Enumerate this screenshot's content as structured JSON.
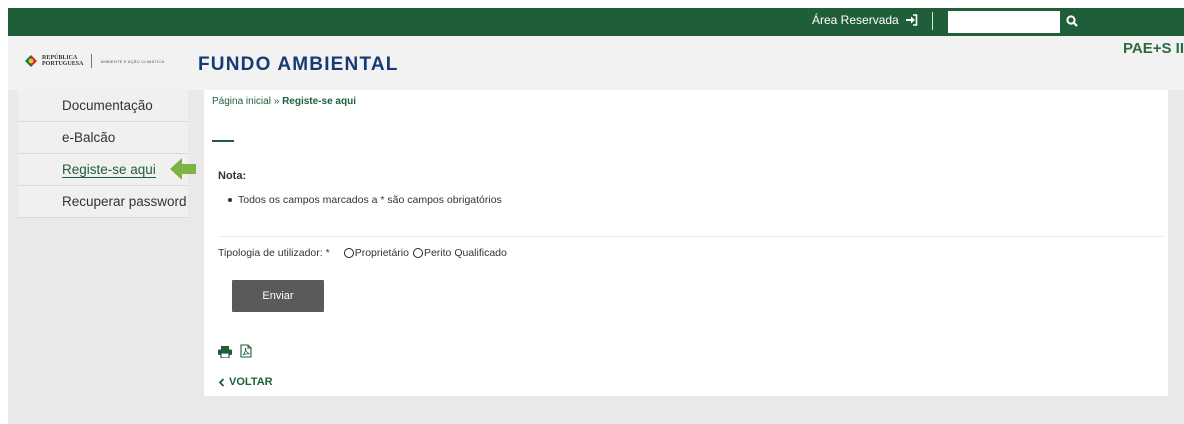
{
  "topbar": {
    "area_reservada": "Área Reservada",
    "search_placeholder": ""
  },
  "header": {
    "rp_line1": "REPÚBLICA",
    "rp_line2": "PORTUGUESA",
    "rp_ministry": "AMBIENTE E AÇÃO CLIMÁTICA",
    "fa_logo": "FUNDO AMBIENTAL",
    "title": "PAE+S II"
  },
  "sidebar": {
    "items": [
      {
        "label": "Documentação"
      },
      {
        "label": "e-Balcão"
      },
      {
        "label": "Registe-se aqui"
      },
      {
        "label": "Recuperar password"
      }
    ]
  },
  "breadcrumb": {
    "home": "Página inicial",
    "separator": "»",
    "current": "Registe-se aqui"
  },
  "nota": {
    "label": "Nota:",
    "items": [
      "Todos os campos marcados a * são campos obrigatórios"
    ]
  },
  "form": {
    "tipologia_label": "Tipologia de utilizador: *",
    "options": [
      "Proprietário",
      "Perito Qualificado"
    ],
    "submit_label": "Enviar"
  },
  "back_label": "VOLTAR",
  "colors": {
    "brand_green": "#1f5e38",
    "logo_blue": "#183a72",
    "arrow_green": "#7cb342",
    "button_gray": "#5a5a5a"
  }
}
